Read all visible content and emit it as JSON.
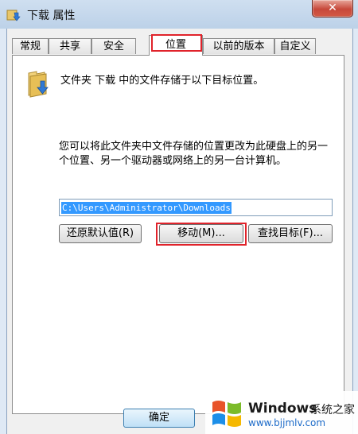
{
  "window": {
    "title": "下载 属性",
    "close_label": "✕"
  },
  "tabs": [
    {
      "label": "常规"
    },
    {
      "label": "共享"
    },
    {
      "label": "安全"
    },
    {
      "label": "位置",
      "active": true
    },
    {
      "label": "以前的版本"
    },
    {
      "label": "自定义"
    }
  ],
  "location": {
    "description": "文件夹 下载 中的文件存储于以下目标位置。",
    "info": "您可以将此文件夹中文件存储的位置更改为此硬盘上的另一个位置、另一个驱动器或网络上的另一台计算机。",
    "path": "C:\\Users\\Administrator\\Downloads",
    "restore_button": "还原默认值(R)",
    "move_button": "移动(M)...",
    "find_target_button": "查找目标(F)..."
  },
  "footer": {
    "ok_button": "确定"
  },
  "watermark": {
    "brand": "Windows",
    "brand_cn": "系统之家",
    "url": "www.bjjmlv.com"
  },
  "colors": {
    "highlight": "#e0232b",
    "selection": "#3399ff"
  }
}
